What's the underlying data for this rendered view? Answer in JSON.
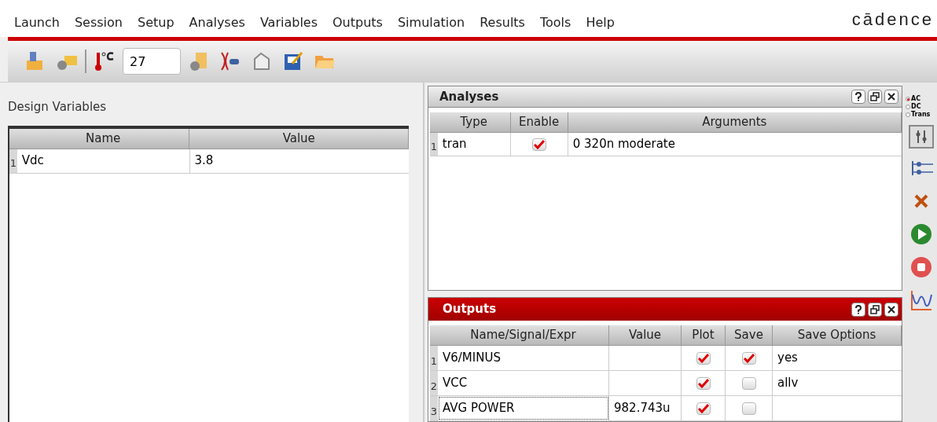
{
  "menu": {
    "items": [
      "Launch",
      "Session",
      "Setup",
      "Analyses",
      "Variables",
      "Outputs",
      "Simulation",
      "Results",
      "Tools",
      "Help"
    ],
    "logo": "cādence"
  },
  "toolbar": {
    "temperature": "27"
  },
  "design_variables": {
    "title": "Design Variables",
    "columns": [
      "Name",
      "Value"
    ],
    "rows": [
      {
        "index": "1",
        "name": "Vdc",
        "value": "3.8"
      }
    ]
  },
  "analyses": {
    "title": "Analyses",
    "columns": [
      "Type",
      "Enable",
      "Arguments"
    ],
    "rows": [
      {
        "index": "1",
        "type": "tran",
        "enabled": true,
        "arguments": "0 320n moderate"
      }
    ]
  },
  "outputs": {
    "title": "Outputs",
    "columns": [
      "Name/Signal/Expr",
      "Value",
      "Plot",
      "Save",
      "Save Options"
    ],
    "rows": [
      {
        "index": "1",
        "name": "V6/MINUS",
        "value": "",
        "plot": true,
        "save": true,
        "save_options": "yes",
        "focused": false
      },
      {
        "index": "2",
        "name": "VCC",
        "value": "",
        "plot": true,
        "save": false,
        "save_options": "allv",
        "focused": false
      },
      {
        "index": "3",
        "name": "AVG POWER",
        "value": "982.743u",
        "plot": true,
        "save": false,
        "save_options": "",
        "focused": true
      }
    ]
  },
  "side_toolbar": {
    "analysis_types": [
      {
        "label": "AC",
        "selected": true
      },
      {
        "label": "DC",
        "selected": false
      },
      {
        "label": "Trans",
        "selected": false
      }
    ]
  }
}
